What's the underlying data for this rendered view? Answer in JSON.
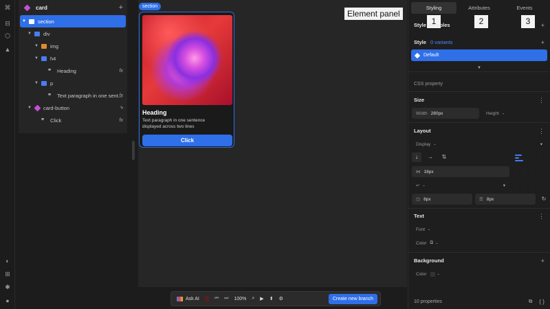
{
  "rail": {
    "icons": [
      "logo-icon",
      "layers-icon",
      "components-icon",
      "assets-icon",
      "palette-icon",
      "gift-icon",
      "bug-icon",
      "help-icon"
    ]
  },
  "layers": {
    "title": "card",
    "add": "+",
    "nodes": [
      {
        "label": "section"
      },
      {
        "label": "div"
      },
      {
        "label": "img"
      },
      {
        "label": "h4"
      },
      {
        "label": "Heading",
        "fx": "fx"
      },
      {
        "label": "p"
      },
      {
        "label": "Text paragraph in one sent...",
        "fx": "fx"
      },
      {
        "label": "card-button"
      },
      {
        "label": "Click",
        "fx": "fx"
      }
    ]
  },
  "canvas": {
    "section_tag": "section",
    "card": {
      "heading": "Heading",
      "text": "Text paragraph in one sentence displayed across two lines",
      "button": "Click"
    },
    "element_panel_label": "Element panel"
  },
  "toolbar": {
    "ask_ai": "Ask AI",
    "zoom": "100%",
    "create_branch": "Create new branch"
  },
  "inspector": {
    "tabs": [
      "Styling",
      "Attributes",
      "Events"
    ],
    "badges": [
      "1",
      "2",
      "3"
    ],
    "style_variables": "Style variables",
    "style": "Style",
    "variants": "0 variants",
    "default": "Default",
    "css_property": "CSS property",
    "size": {
      "title": "Size",
      "width_label": "Width",
      "width_value": "280px",
      "height_label": "Height",
      "height_value": "-"
    },
    "layout": {
      "title": "Layout",
      "display_label": "Display",
      "display_value": "-",
      "gap_value": "16px",
      "wrap_value": "-",
      "padding_h": "8px",
      "padding_v": "8px"
    },
    "text": {
      "title": "Text",
      "font_label": "Font",
      "font_value": "-",
      "color_label": "Color",
      "color_value": "-"
    },
    "background": {
      "title": "Background",
      "color_label": "Color",
      "color_value": "-"
    },
    "footer": "10 properties"
  },
  "colors": {
    "accent": "#2f6fe8",
    "panel": "#252525",
    "canvas": "#262626"
  }
}
